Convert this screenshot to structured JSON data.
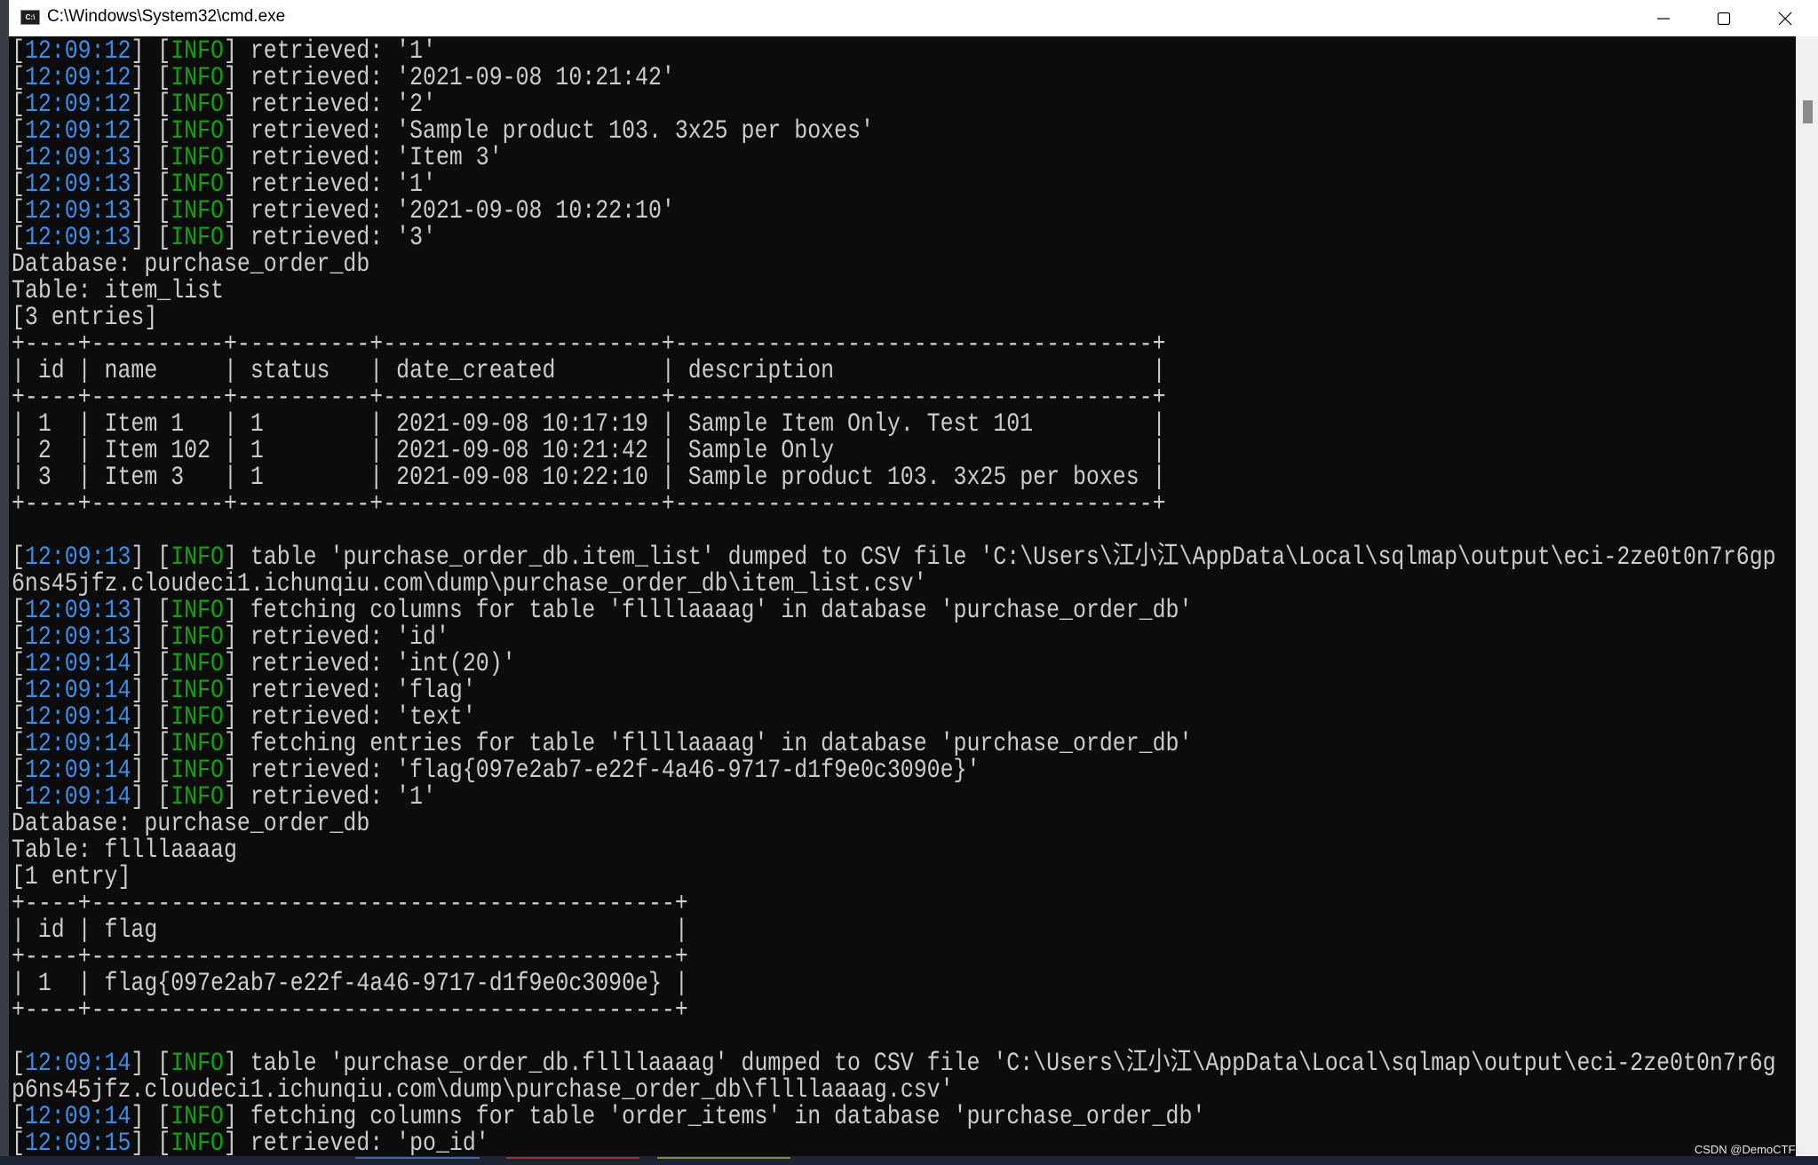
{
  "window": {
    "title": "C:\\Windows\\System32\\cmd.exe",
    "icon_label": "C:\\",
    "buttons": [
      "minimize-icon",
      "maximize-icon",
      "close-icon"
    ]
  },
  "colors": {
    "background": "#0c0c0c",
    "text": "#cccccc",
    "timestamp": "#3b8eea",
    "info": "#13a10e"
  },
  "lines": [
    {
      "ts": "12:09:12",
      "level": "INFO",
      "msg": "retrieved: '1'"
    },
    {
      "ts": "12:09:12",
      "level": "INFO",
      "msg": "retrieved: '2021-09-08 10:21:42'"
    },
    {
      "ts": "12:09:12",
      "level": "INFO",
      "msg": "retrieved: '2'"
    },
    {
      "ts": "12:09:12",
      "level": "INFO",
      "msg": "retrieved: 'Sample product 103. 3x25 per boxes'"
    },
    {
      "ts": "12:09:13",
      "level": "INFO",
      "msg": "retrieved: 'Item 3'"
    },
    {
      "ts": "12:09:13",
      "level": "INFO",
      "msg": "retrieved: '1'"
    },
    {
      "ts": "12:09:13",
      "level": "INFO",
      "msg": "retrieved: '2021-09-08 10:22:10'"
    },
    {
      "ts": "12:09:13",
      "level": "INFO",
      "msg": "retrieved: '3'"
    },
    {
      "plain": "Database: purchase_order_db"
    },
    {
      "plain": "Table: item_list"
    },
    {
      "plain": "[3 entries]"
    },
    {
      "table": {
        "headers": [
          "id",
          "name",
          "status",
          "date_created",
          "description"
        ],
        "rows": [
          [
            "1",
            "Item 1",
            "1",
            "2021-09-08 10:17:19",
            "Sample Item Only. Test 101"
          ],
          [
            "2",
            "Item 102",
            "1",
            "2021-09-08 10:21:42",
            "Sample Only"
          ],
          [
            "3",
            "Item 3",
            "1",
            "2021-09-08 10:22:10",
            "Sample product 103. 3x25 per boxes"
          ]
        ]
      }
    },
    {
      "plain": ""
    },
    {
      "ts": "12:09:13",
      "level": "INFO",
      "msg": "table 'purchase_order_db.item_list' dumped to CSV file 'C:\\Users\\江小江\\AppData\\Local\\sqlmap\\output\\eci-2ze0t0n7r6gp",
      "wrap": "6ns45jfz.cloudeci1.ichunqiu.com\\dump\\purchase_order_db\\item_list.csv'"
    },
    {
      "ts": "12:09:13",
      "level": "INFO",
      "msg": "fetching columns for table 'fllllaaaag' in database 'purchase_order_db'"
    },
    {
      "ts": "12:09:13",
      "level": "INFO",
      "msg": "retrieved: 'id'"
    },
    {
      "ts": "12:09:14",
      "level": "INFO",
      "msg": "retrieved: 'int(20)'"
    },
    {
      "ts": "12:09:14",
      "level": "INFO",
      "msg": "retrieved: 'flag'"
    },
    {
      "ts": "12:09:14",
      "level": "INFO",
      "msg": "retrieved: 'text'"
    },
    {
      "ts": "12:09:14",
      "level": "INFO",
      "msg": "fetching entries for table 'fllllaaaag' in database 'purchase_order_db'"
    },
    {
      "ts": "12:09:14",
      "level": "INFO",
      "msg": "retrieved: 'flag{097e2ab7-e22f-4a46-9717-d1f9e0c3090e}'"
    },
    {
      "ts": "12:09:14",
      "level": "INFO",
      "msg": "retrieved: '1'"
    },
    {
      "plain": "Database: purchase_order_db"
    },
    {
      "plain": "Table: fllllaaaag"
    },
    {
      "plain": "[1 entry]"
    },
    {
      "table": {
        "headers": [
          "id",
          "flag"
        ],
        "rows": [
          [
            "1",
            "flag{097e2ab7-e22f-4a46-9717-d1f9e0c3090e}"
          ]
        ]
      }
    },
    {
      "plain": ""
    },
    {
      "ts": "12:09:14",
      "level": "INFO",
      "msg": "table 'purchase_order_db.fllllaaaag' dumped to CSV file 'C:\\Users\\江小江\\AppData\\Local\\sqlmap\\output\\eci-2ze0t0n7r6g",
      "wrap": "p6ns45jfz.cloudeci1.ichunqiu.com\\dump\\purchase_order_db\\fllllaaaag.csv'"
    },
    {
      "ts": "12:09:14",
      "level": "INFO",
      "msg": "fetching columns for table 'order_items' in database 'purchase_order_db'"
    },
    {
      "ts": "12:09:15",
      "level": "INFO",
      "msg": "retrieved: 'po_id'"
    }
  ],
  "scrollbar": {
    "position_fraction": 0.04
  },
  "watermark": "CSDN @DemoCTFer"
}
